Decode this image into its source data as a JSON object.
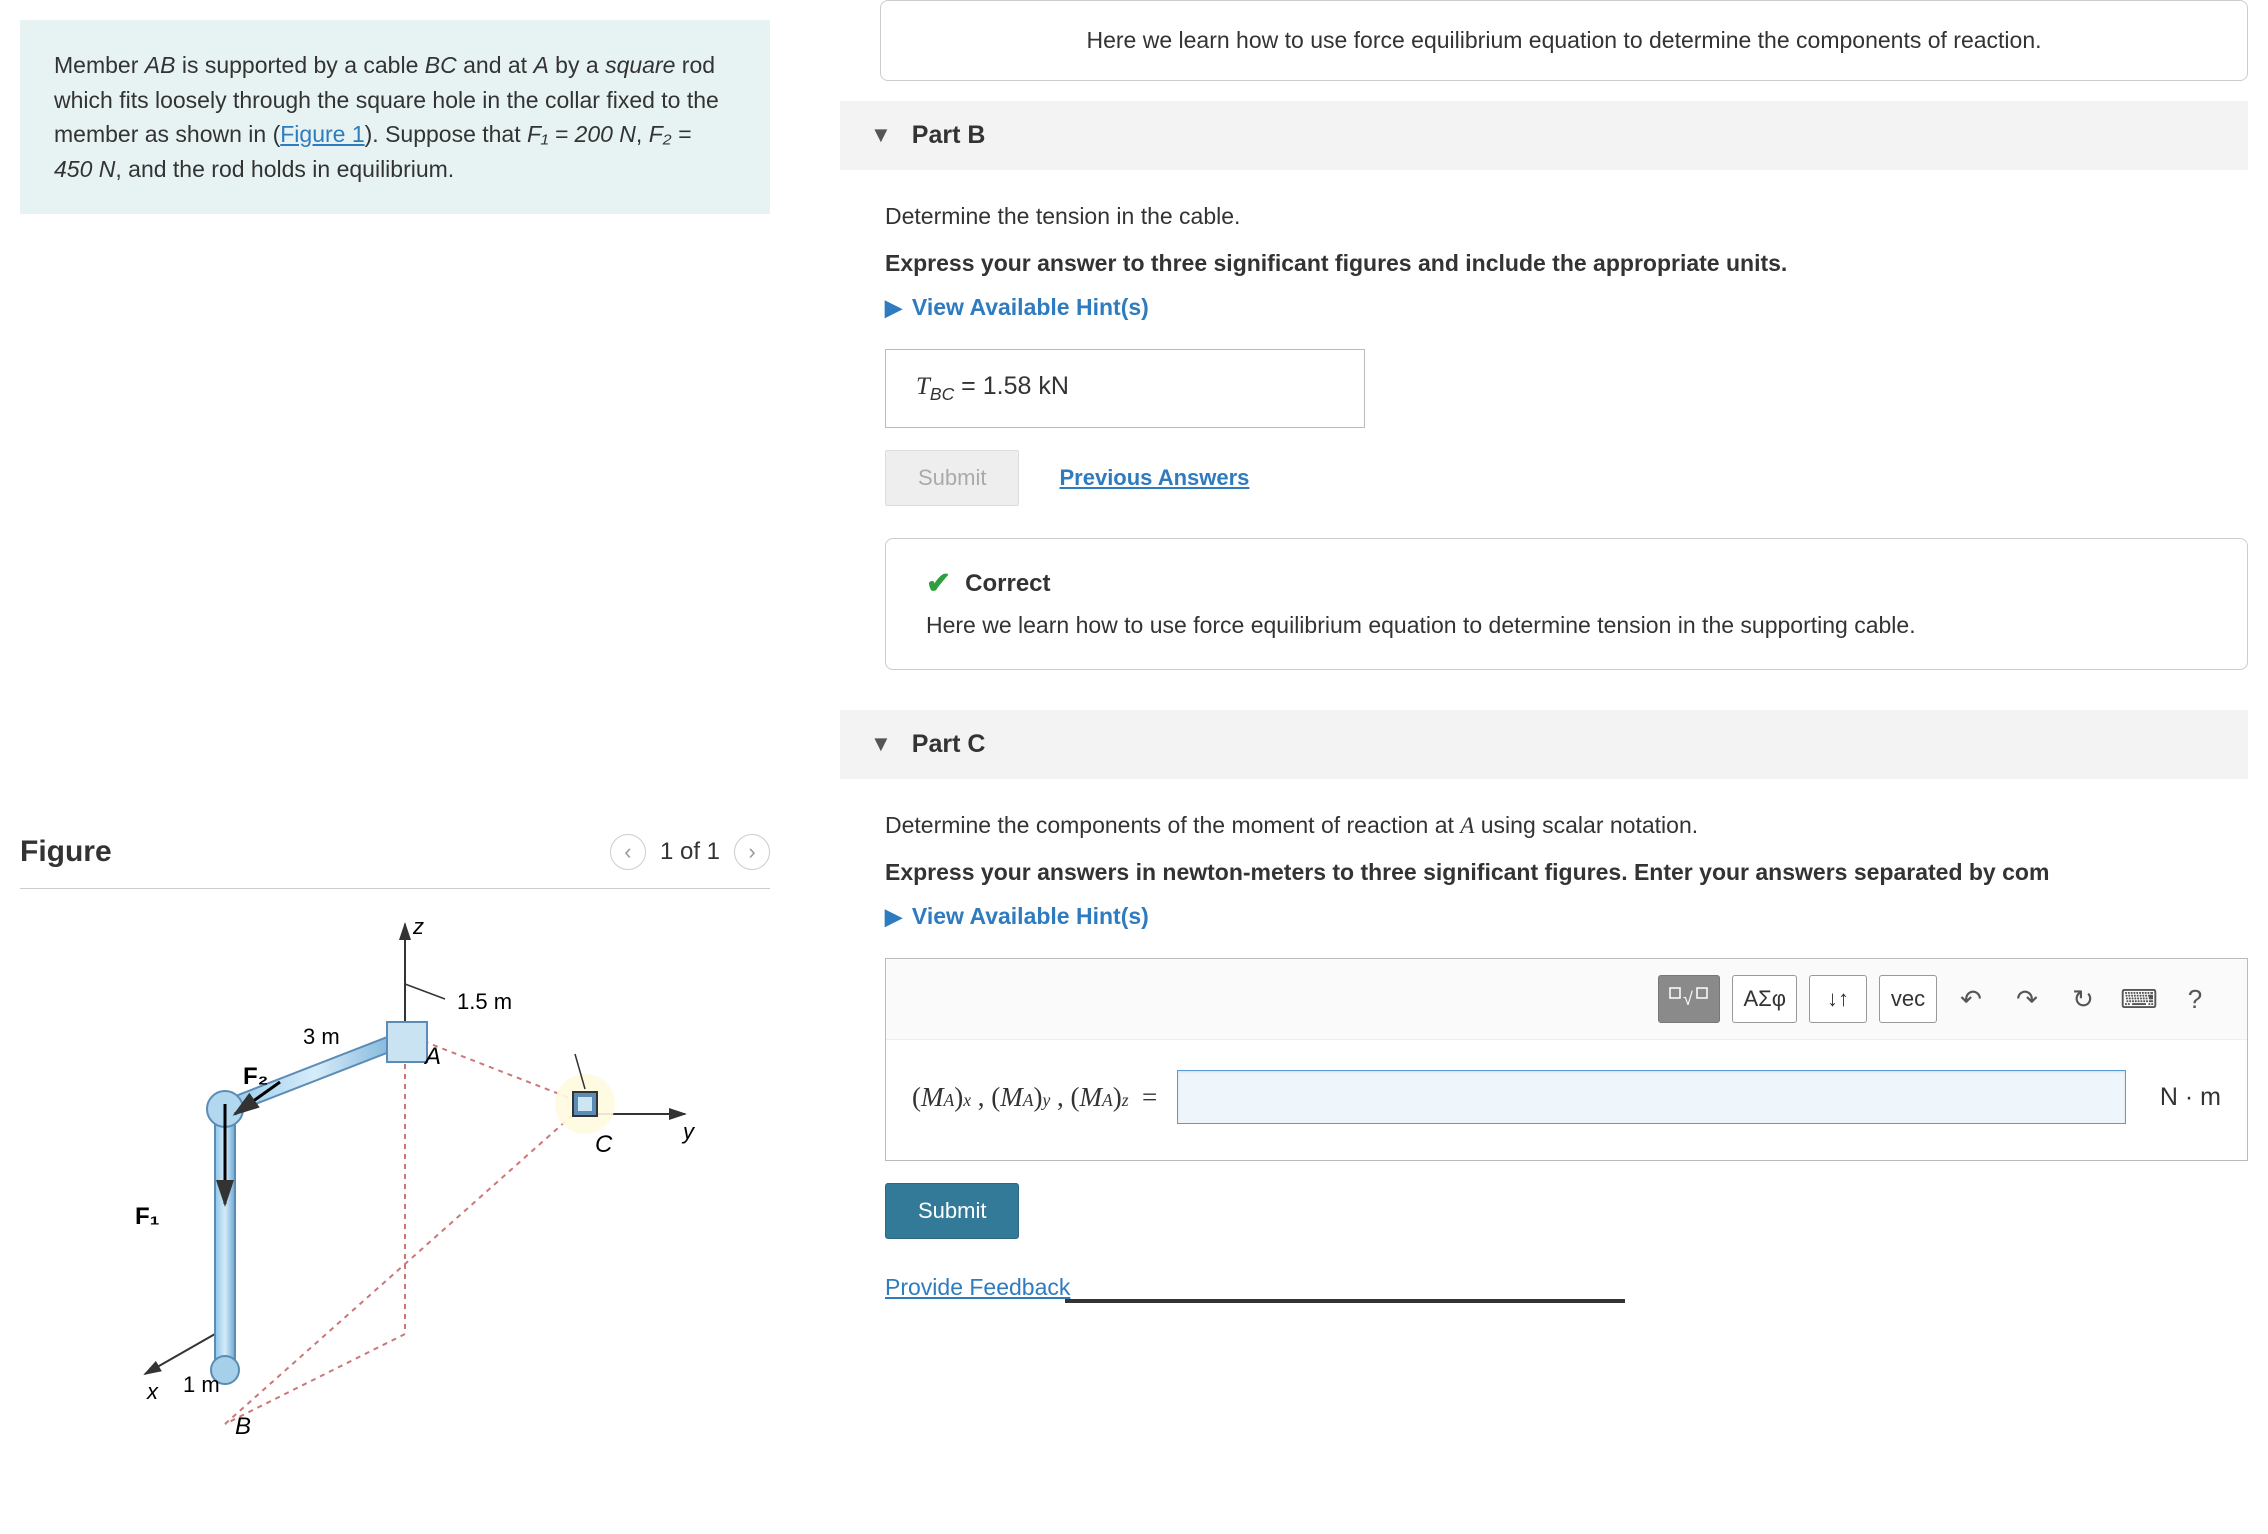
{
  "problem": {
    "text_pre": "Member ",
    "ab": "AB",
    "text_mid1": " is supported by a cable ",
    "bc": "BC",
    "text_mid2": " and at ",
    "a": "A",
    "text_mid3": " by a ",
    "square": "square",
    "text_mid4": " rod which fits loosely through the square hole in the collar fixed to the member as shown in (",
    "figlink": "Figure 1",
    "text_mid5": "). Suppose that ",
    "f1eq": "F₁ = 200 N",
    "comma": ", ",
    "f2eq": "F₂ = 450 N",
    "text_end": ", and the rod holds in equilibrium."
  },
  "figure": {
    "heading": "Figure",
    "pager": "1 of 1",
    "labels": {
      "z": "z",
      "y": "y",
      "x": "x",
      "A": "A",
      "B": "B",
      "C": "C",
      "F1": "F₁",
      "F2": "F₂",
      "d1": "3 m",
      "d2": "1.5 m",
      "d3": "1 m"
    }
  },
  "partA_feedback": {
    "text": "Here we learn how to use force equilibrium equation to determine the components of reaction."
  },
  "partB": {
    "title": "Part B",
    "instr1": "Determine the tension in the cable.",
    "instr2": "Express your answer to three significant figures and include the appropriate units.",
    "hints": "View Available Hint(s)",
    "answer_var": "T",
    "answer_sub": "BC",
    "answer_eq": " = ",
    "answer_val": "1.58 kN",
    "submit": "Submit",
    "prev": "Previous Answers",
    "correct": "Correct",
    "feedback": "Here we learn how to use force equilibrium equation to determine tension in the supporting cable."
  },
  "partC": {
    "title": "Part C",
    "instr1_pre": "Determine the components of the moment of reaction at ",
    "instr1_A": "A",
    "instr1_post": " using scalar notation.",
    "instr2": "Express your answers in newton-meters to three significant figures. Enter your answers separated by com",
    "hints": "View Available Hint(s)",
    "toolbar": {
      "template": "▭√▭",
      "greek": "ΑΣφ",
      "updown": "↓↑",
      "vec": "vec",
      "undo": "↶",
      "redo": "↷",
      "reset": "↻",
      "keyboard": "⌨",
      "help": "?"
    },
    "label_full": "(Mₐ)ₓ , (Mₐ)ᵧ , (Mₐ)_z  =",
    "unit": "N · m",
    "submit": "Submit"
  },
  "footer": {
    "provide": "Provide Feedback"
  }
}
